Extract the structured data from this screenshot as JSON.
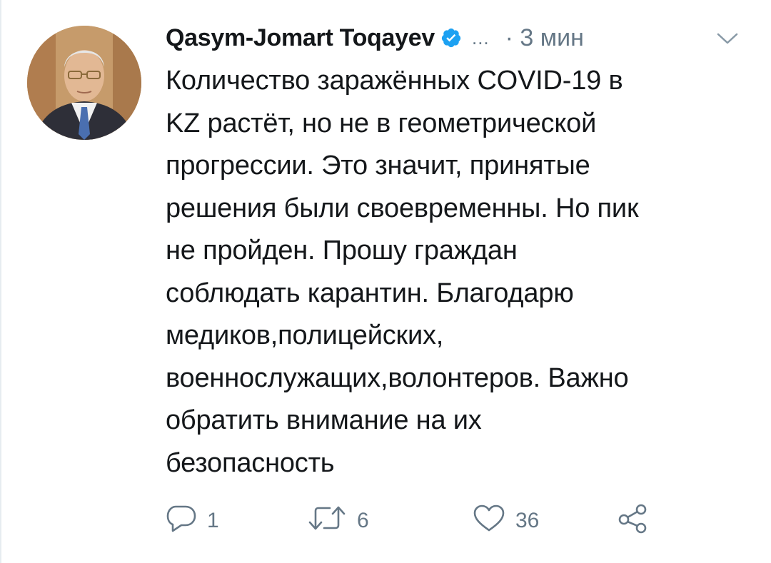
{
  "tweet": {
    "author_name": "Qasym-Jomart Toqayev",
    "verified": true,
    "ellipsis": "...",
    "time": "· 3 мин",
    "text": "Количество заражённых COVID-19 в\nKZ растёт, но не в геометрической\nпрогрессии. Это значит, принятые\nрешения были своевременны. Но пик\nне пройден. Прошу граждан\nсоблюдать карантин. Благодарю\nмедиков,полицейских,\nвоеннослужащих,волонтеров. Важно\nобратить внимание на их\nбезопасность"
  },
  "actions": {
    "reply_count": "1",
    "retweet_count": "6",
    "like_count": "36"
  },
  "colors": {
    "text": "#14171a",
    "secondary": "#657786",
    "verified_blue": "#1da1f2"
  },
  "icons": [
    "verified-badge-icon",
    "chevron-down-icon",
    "reply-icon",
    "retweet-icon",
    "heart-icon",
    "share-icon"
  ]
}
